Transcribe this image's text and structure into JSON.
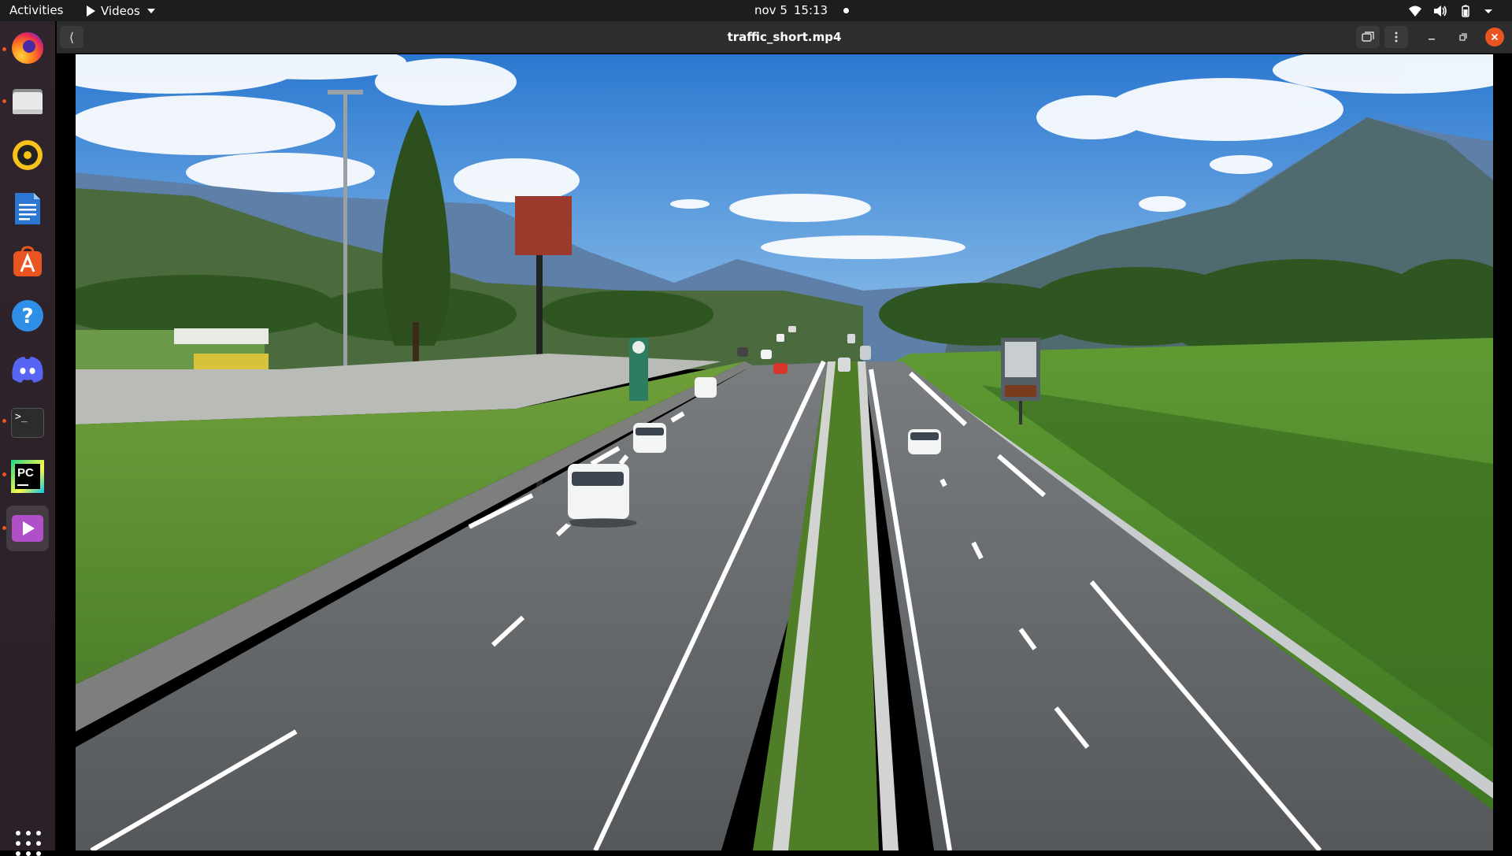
{
  "topbar": {
    "activities": "Activities",
    "app_menu": "Videos",
    "date": "nov 5",
    "time": "15:13"
  },
  "dock": {
    "items": [
      {
        "name": "firefox",
        "running": true
      },
      {
        "name": "files",
        "running": true
      },
      {
        "name": "rhythmbox",
        "running": false
      },
      {
        "name": "libreoffice-writer",
        "running": false
      },
      {
        "name": "ubuntu-software",
        "running": false
      },
      {
        "name": "help",
        "running": false
      },
      {
        "name": "discord",
        "running": false
      },
      {
        "name": "terminal",
        "running": true
      },
      {
        "name": "pycharm",
        "running": true
      },
      {
        "name": "videos",
        "running": true,
        "active": true
      }
    ],
    "pycharm_label": "PC",
    "terminal_label": ">_"
  },
  "window": {
    "title": "traffic_short.mp4",
    "back_glyph": "⟨"
  },
  "colors": {
    "accent": "#e95420",
    "topbar": "#1d1d1d",
    "headerbar": "#2d2d2d",
    "dock": "#2b2329"
  }
}
